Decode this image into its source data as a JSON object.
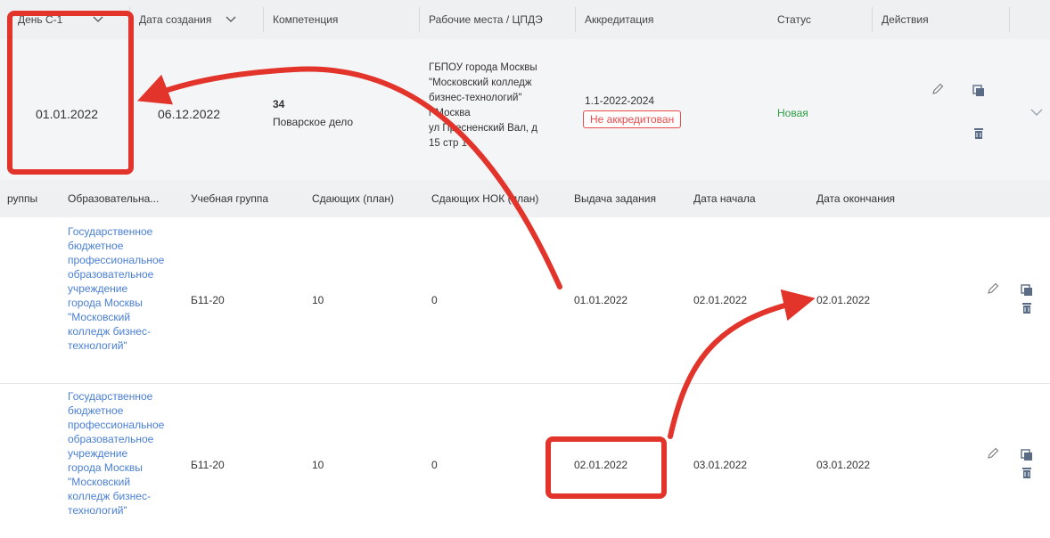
{
  "header": {
    "columns": [
      {
        "label": "День С-1",
        "sortable": true
      },
      {
        "label": "Дата создания",
        "sortable": true
      },
      {
        "label": "Компетенция"
      },
      {
        "label": "Рабочие места / ЦПДЭ"
      },
      {
        "label": "Аккредитация"
      },
      {
        "label": "Статус"
      },
      {
        "label": "Действия"
      }
    ]
  },
  "main_row": {
    "day_c1": "01.01.2022",
    "created": "06.12.2022",
    "competence_code": "34",
    "competence_name": "Поварское дело",
    "workplace_lines": [
      "ГБПОУ города Москвы",
      "\"Московский колледж",
      "бизнес-технологий\"",
      "г Москва",
      "ул Пресненский Вал, д",
      "15 стр 1"
    ],
    "accreditation_code": "1.1-2022-2024",
    "accreditation_badge": "Не аккредитован",
    "status": "Новая"
  },
  "sub_header": {
    "columns": [
      "руппы",
      "Образовательна...",
      "Учебная группа",
      "Сдающих (план)",
      "Сдающих НОК (план)",
      "Выдача задания",
      "Дата начала",
      "Дата окончания"
    ]
  },
  "sub_rows": [
    {
      "org_lines": [
        "Государственное",
        "бюджетное",
        "профессиональное",
        "образовательное",
        "учреждение",
        "города Москвы",
        "\"Московский",
        "колледж бизнес-",
        "технологий\""
      ],
      "group": "Б11-20",
      "plan": "10",
      "nok_plan": "0",
      "issue_date": "01.01.2022",
      "start_date": "02.01.2022",
      "end_date": "02.01.2022"
    },
    {
      "org_lines": [
        "Государственное",
        "бюджетное",
        "профессиональное",
        "образовательное",
        "учреждение",
        "города Москвы",
        "\"Московский",
        "колледж бизнес-",
        "технологий\""
      ],
      "group": "Б11-20",
      "plan": "10",
      "nok_plan": "0",
      "issue_date": "02.01.2022",
      "start_date": "03.01.2022",
      "end_date": "03.01.2022"
    }
  ],
  "icons": {
    "edit": "pencil-icon",
    "copy": "copy-icon",
    "delete": "trash-icon",
    "expand": "chevron-down-icon"
  },
  "colors": {
    "link": "#4a7fd4",
    "badge_red": "#e94a4a",
    "status_green": "#2e9e44",
    "annotation_red": "#e2342b"
  }
}
